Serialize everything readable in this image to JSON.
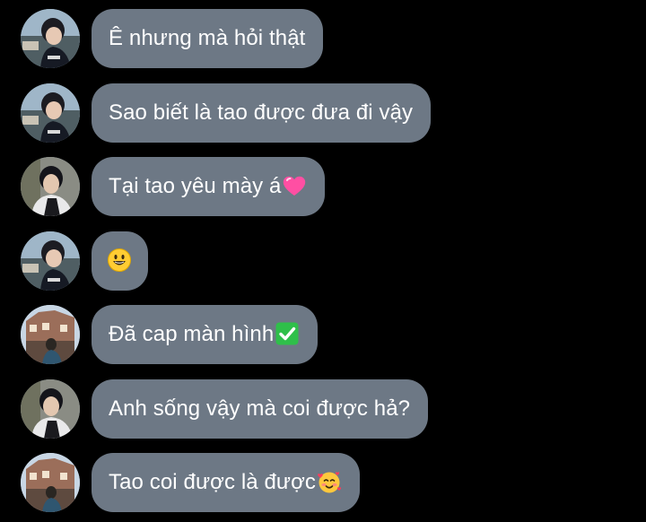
{
  "messages": [
    {
      "sender": "a",
      "text": "Ê nhưng mà hỏi thật",
      "emoji": ""
    },
    {
      "sender": "a",
      "text": "Sao biết là tao được đưa đi vậy",
      "emoji": ""
    },
    {
      "sender": "b",
      "text": "Tại tao yêu mày á",
      "emoji": "pink-heart-icon"
    },
    {
      "sender": "a",
      "text": "",
      "emoji": "smiling-face-icon"
    },
    {
      "sender": "c",
      "text": "Đã cap màn hình",
      "emoji": "check-mark-button-icon"
    },
    {
      "sender": "b",
      "text": "Anh sống vậy mà coi được hả?",
      "emoji": ""
    },
    {
      "sender": "c",
      "text": "Tao coi được là được",
      "emoji": "smiling-face-with-hearts-icon"
    }
  ],
  "colors": {
    "background": "#000000",
    "bubble": "#6d7885",
    "text": "#ffffff"
  }
}
